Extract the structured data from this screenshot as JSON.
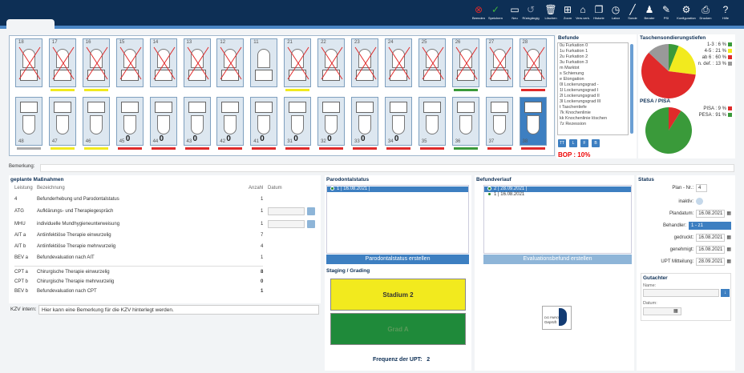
{
  "toolbar": [
    {
      "label": "Beenden",
      "icon": "close-circle-icon",
      "color": "#e02a2a"
    },
    {
      "label": "Speichern",
      "icon": "check-icon",
      "color": "#3fb63f"
    },
    {
      "label": "Neu",
      "icon": "new-icon",
      "color": "#ffffff"
    },
    {
      "label": "Rückgängig",
      "icon": "undo-icon",
      "color": "#7f8fa6"
    },
    {
      "label": "Löschen",
      "icon": "trash-icon",
      "color": "#ffffff"
    },
    {
      "label": "Zoom",
      "icon": "zoom-icon",
      "color": "#ffffff"
    },
    {
      "label": "Vers.verk.",
      "icon": "tag-icon",
      "color": "#ffffff"
    },
    {
      "label": "Historie",
      "icon": "history-icon",
      "color": "#ffffff"
    },
    {
      "label": "Labor",
      "icon": "clock-icon",
      "color": "#ffffff"
    },
    {
      "label": "Sonde",
      "icon": "probe-icon",
      "color": "#ffffff"
    },
    {
      "label": "Berater",
      "icon": "person-icon",
      "color": "#ffffff"
    },
    {
      "label": "PSI",
      "icon": "pen-icon",
      "color": "#ffffff"
    },
    {
      "label": "Konfiguration",
      "icon": "gear-icon",
      "color": "#ffffff"
    },
    {
      "label": "Drucken",
      "icon": "printer-icon",
      "color": "#ffffff"
    },
    {
      "label": "Hilfe",
      "icon": "help-icon",
      "color": "#ffffff"
    }
  ],
  "upper_teeth": [
    "18",
    "17",
    "16",
    "15",
    "14",
    "13",
    "12",
    "11",
    "21",
    "22",
    "23",
    "24",
    "25",
    "26",
    "27",
    "28"
  ],
  "lower_teeth": [
    "48",
    "47",
    "46",
    "45",
    "44",
    "43",
    "42",
    "41",
    "31",
    "32",
    "33",
    "34",
    "35",
    "36",
    "37",
    "38"
  ],
  "lower_zero": "0",
  "findings": {
    "title": "Befunde",
    "items": [
      "0u  Furkation 0",
      "1u  Furkation 1",
      "2u  Furkation 2",
      "3u  Furkation 3",
      "m   Marktot",
      "s   Schienung",
      "e   Elongation",
      "0l  Lockerungsgrad -",
      "1l  Lockerungsgrad I",
      "2l  Lockerungsgrad II",
      "3l  Lockerungsgrad III",
      "t   Taschentiefe",
      "7k  Knochenlinie",
      "kk  Knochenlinie löschen",
      "7z  Rezession"
    ],
    "buttons": [
      "TT",
      "L",
      "F",
      "B"
    ],
    "bop": "BOP : 10%"
  },
  "pies": {
    "title1": "Taschensondierungstiefen",
    "legend1": [
      "1-3 : 6 %",
      "4-5 : 21 %",
      "ab 6 : 60 %",
      "n. def. : 13 %"
    ],
    "title2": "PESA / PISA",
    "legend2": [
      "PISA : 9 %",
      "PESA : 91 %"
    ],
    "colors": {
      "green": "#3a9a3a",
      "yellow": "#f2ea1e",
      "red": "#e02a2a",
      "gray": "#999999"
    }
  },
  "chart_data": [
    {
      "type": "pie",
      "title": "Taschensondierungstiefen",
      "categories": [
        "1-3",
        "4-5",
        "ab 6",
        "n. def."
      ],
      "values": [
        6,
        21,
        60,
        13
      ]
    },
    {
      "type": "pie",
      "title": "PESA / PISA",
      "categories": [
        "PISA",
        "PESA"
      ],
      "values": [
        9,
        91
      ]
    }
  ],
  "remark": {
    "label": "Bemerkung:",
    "value": ""
  },
  "measures": {
    "title": "geplante Maßnahmen",
    "headers": {
      "leistung": "Leistung",
      "bez": "Bezeichnung",
      "anzahl": "Anzahl",
      "datum": "Datum"
    },
    "rows": [
      {
        "code": "4",
        "name": "Befunderhebung und Parodontalstatus",
        "qty": "1"
      },
      {
        "code": "ATG",
        "name": "Aufklärungs- und Therapiegespräch",
        "qty": "1"
      },
      {
        "code": "MHU",
        "name": "individuelle Mundhygieneunterweisung",
        "qty": "1"
      },
      {
        "code": "AIT a",
        "name": "Antiinfektiöse Therapie einwurzelig",
        "qty": "7"
      },
      {
        "code": "AIT b",
        "name": "Antiinfektiöse Therapie mehrwurzelig",
        "qty": "4"
      },
      {
        "code": "BEV a",
        "name": "Befundevaluation nach AIT",
        "qty": "1"
      },
      {
        "code": "CPT a",
        "name": "Chirurgische Therapie einwurzelig",
        "qty": "8"
      },
      {
        "code": "CPT b",
        "name": "Chirurgische Therapie mehrwurzelig",
        "qty": "0"
      },
      {
        "code": "BEV b",
        "name": "Befundevaluation nach CPT",
        "qty": "1"
      }
    ]
  },
  "kzv": {
    "label": "KZV intern:",
    "value": "Hier kann eine Bemerkung für die KZV hinterlegt werden."
  },
  "paro": {
    "title": "Parodontalstatus",
    "items": [
      "1 | 16.08.2021 |"
    ],
    "create_button": "Parodontalstatus erstellen",
    "staging_title": "Staging / Grading",
    "stadium": "Stadium 2",
    "grad": "Grad A",
    "freq_label": "Frequenz der UPT:",
    "freq_value": "2"
  },
  "befv": {
    "title": "Befundverlauf",
    "items": [
      "2 | 28.09.2021 |",
      "1 | 16.08.2021"
    ],
    "eval_button": "Evaluationsbefund erstellen",
    "badge_text1": "DG PARO",
    "badge_text2": "Geprüft"
  },
  "status": {
    "title": "Status",
    "plan_label": "Plan - Nr.:",
    "plan_value": "4",
    "inaktiv_label": "inaktiv:",
    "plandatum_label": "Plandatum:",
    "plandatum_value": "16.08.2021",
    "behandler_label": "Behandler:",
    "behandler_value": "1 - z1",
    "gedruckt_label": "gedruckt:",
    "gedruckt_value": "16.08.2021",
    "genehmigt_label": "genehmigt:",
    "genehmigt_value": "16.08.2021",
    "upt_label": "UPT Mitteilung:",
    "upt_value": "28.09.2021",
    "gutachter_title": "Gutachter",
    "name_label": "Name:",
    "datum_label": "Datum:"
  }
}
